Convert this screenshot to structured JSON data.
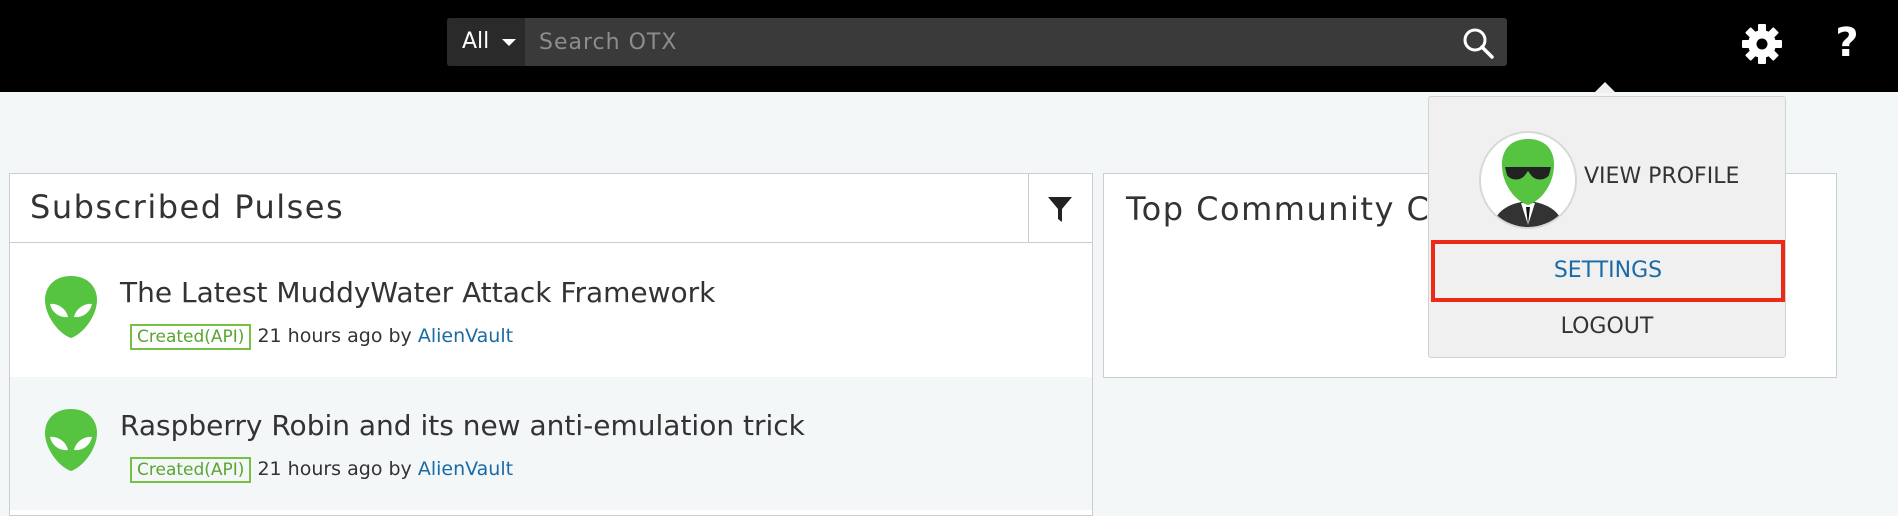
{
  "header": {
    "search": {
      "scope_label": "All",
      "placeholder": "Search OTX"
    },
    "help_label": "?"
  },
  "pulses_panel": {
    "title": "Subscribed Pulses",
    "items": [
      {
        "title": "The Latest MuddyWater Attack Framework",
        "badge": "Created(API)",
        "time": "21 hours ago",
        "by": "by",
        "author": "AlienVault"
      },
      {
        "title": "Raspberry Robin and its new anti-emulation trick",
        "badge": "Created(API)",
        "time": "21 hours ago",
        "by": "by",
        "author": "AlienVault"
      }
    ]
  },
  "contributors_panel": {
    "title": "Top Community Co"
  },
  "user_menu": {
    "view_profile": "VIEW PROFILE",
    "settings": "SETTINGS",
    "logout": "LOGOUT"
  },
  "colors": {
    "accent_link": "#1a6aa6",
    "badge_green": "#77c043",
    "alien_green": "#56c341",
    "highlight_red": "#ec2a16"
  }
}
